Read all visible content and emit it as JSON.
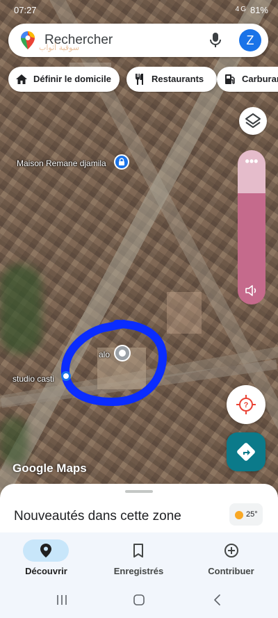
{
  "status_bar": {
    "time": "07:27",
    "network": "4G",
    "battery": "81%"
  },
  "search": {
    "placeholder": "Rechercher",
    "watermark": "سوقية أثواب",
    "avatar_letter": "Z"
  },
  "chips": [
    {
      "label": "Définir le domicile",
      "icon": "home-icon"
    },
    {
      "label": "Restaurants",
      "icon": "fork-knife-icon"
    },
    {
      "label": "Carburant",
      "icon": "gas-station-icon"
    }
  ],
  "map": {
    "labels": {
      "maison": "Maison Remane djamila",
      "alo": "alo",
      "studio": "studio casti"
    },
    "attribution": "Google Maps",
    "highlight_color": "#0a2cff"
  },
  "bottom_sheet": {
    "title": "Nouveautés dans cette zone",
    "weather_temp": "25°"
  },
  "nav": {
    "tabs": [
      {
        "label": "Découvrir",
        "icon": "location-pin-icon",
        "active": true
      },
      {
        "label": "Enregistrés",
        "icon": "bookmark-icon",
        "active": false
      },
      {
        "label": "Contribuer",
        "icon": "add-circle-icon",
        "active": false
      }
    ]
  },
  "colors": {
    "accent": "#1a73e8",
    "directions": "#0b7a8a",
    "volume": "#c56a8c"
  }
}
